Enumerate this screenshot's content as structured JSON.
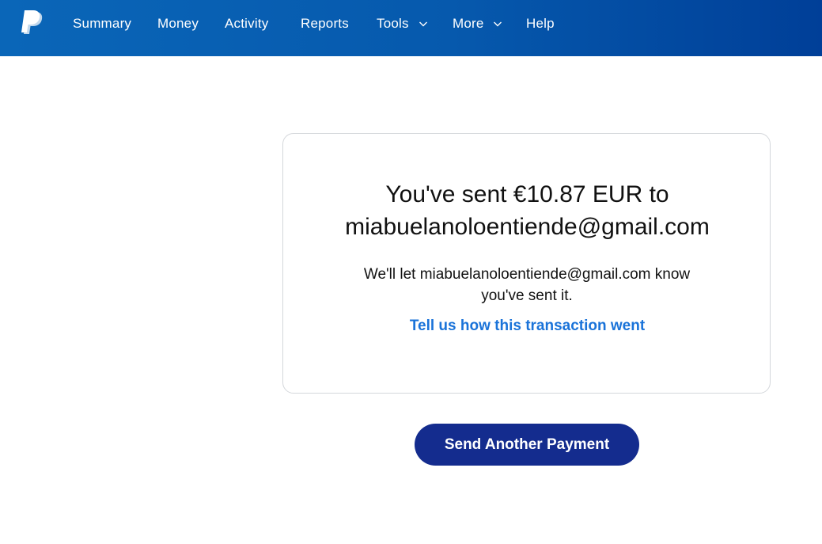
{
  "nav": {
    "logo_icon": "paypal-logo",
    "items": [
      {
        "label": "Summary"
      },
      {
        "label": "Money"
      },
      {
        "label": "Activity"
      },
      {
        "label": "Reports"
      },
      {
        "label": "Tools",
        "dropdown_icon": "chevron-down-icon"
      },
      {
        "label": "More",
        "dropdown_icon": "chevron-down-icon"
      },
      {
        "label": "Help"
      }
    ]
  },
  "confirmation": {
    "headline_line1": "You've sent €10.87 EUR to",
    "headline_line2": "miabuelanoloentiende@gmail.com",
    "notice_line1": "We'll let miabuelanoloentiende@gmail.com know",
    "notice_line2": "you've sent it.",
    "feedback_link": "Tell us how this transaction went"
  },
  "actions": {
    "send_another_label": "Send Another Payment"
  },
  "colors": {
    "header": "#0659ad",
    "button": "#142c8e",
    "link": "#1a73d9"
  }
}
